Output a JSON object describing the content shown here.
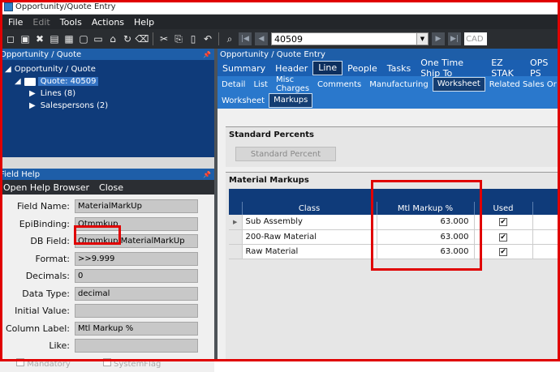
{
  "window": {
    "title": "Opportunity/Quote Entry"
  },
  "menu": [
    "File",
    "Edit",
    "Tools",
    "Actions",
    "Help"
  ],
  "toolbar": {
    "quote_number": "40509",
    "currency": "CAD"
  },
  "tree_panel": {
    "title": "Opportunity / Quote",
    "nodes": [
      {
        "label": "Opportunity / Quote"
      },
      {
        "label": "Quote: 40509"
      },
      {
        "label": "Lines (8)"
      },
      {
        "label": "Salespersons (2)"
      }
    ]
  },
  "field_help": {
    "title": "Field Help",
    "open_help_browser": "Open Help Browser",
    "close": "Close",
    "fields": [
      {
        "label": "Field Name:",
        "value": "MaterialMarkUp"
      },
      {
        "label": "EpiBinding:",
        "value": "Qtmmkup"
      },
      {
        "label": "DB Field:",
        "value": "Qtmmkup.MaterialMarkUp"
      },
      {
        "label": "Format:",
        "value": ">>9.999"
      },
      {
        "label": "Decimals:",
        "value": "0"
      },
      {
        "label": "Data Type:",
        "value": "decimal"
      },
      {
        "label": "Initial Value:",
        "value": ""
      },
      {
        "label": "Column Label:",
        "value": "Mtl Markup %"
      },
      {
        "label": "Like:",
        "value": ""
      }
    ],
    "mandatory_label": "Mandatory",
    "systemflag_label": "SystemFlag"
  },
  "main": {
    "title": "Opportunity / Quote Entry",
    "tabs1": [
      "Summary",
      "Header",
      "Line",
      "People",
      "Tasks",
      "One Time Ship To",
      "EZ STAK",
      "OPS PS"
    ],
    "tabs1_active": "Line",
    "tabs2": [
      "Detail",
      "List",
      "Misc Charges",
      "Comments",
      "Manufacturing",
      "Worksheet",
      "Related Sales Or"
    ],
    "tabs2_active": "Worksheet",
    "tabs3": [
      "Worksheet",
      "Markups"
    ],
    "tabs3_active": "Markups",
    "standard_percents": {
      "title": "Standard Percents",
      "button": "Standard Percent"
    },
    "material_markups": {
      "title": "Material Markups",
      "columns": [
        "Class",
        "Mtl Markup %",
        "Used"
      ],
      "rows": [
        {
          "class": "Sub Assembly",
          "markup": "63.000",
          "used": "✔"
        },
        {
          "class": "200-Raw Material",
          "markup": "63.000",
          "used": "✔"
        },
        {
          "class": "Raw Material",
          "markup": "63.000",
          "used": "✔"
        }
      ]
    }
  },
  "colors": {
    "highlight": "#e00000",
    "accent": "#1b5fb1"
  }
}
